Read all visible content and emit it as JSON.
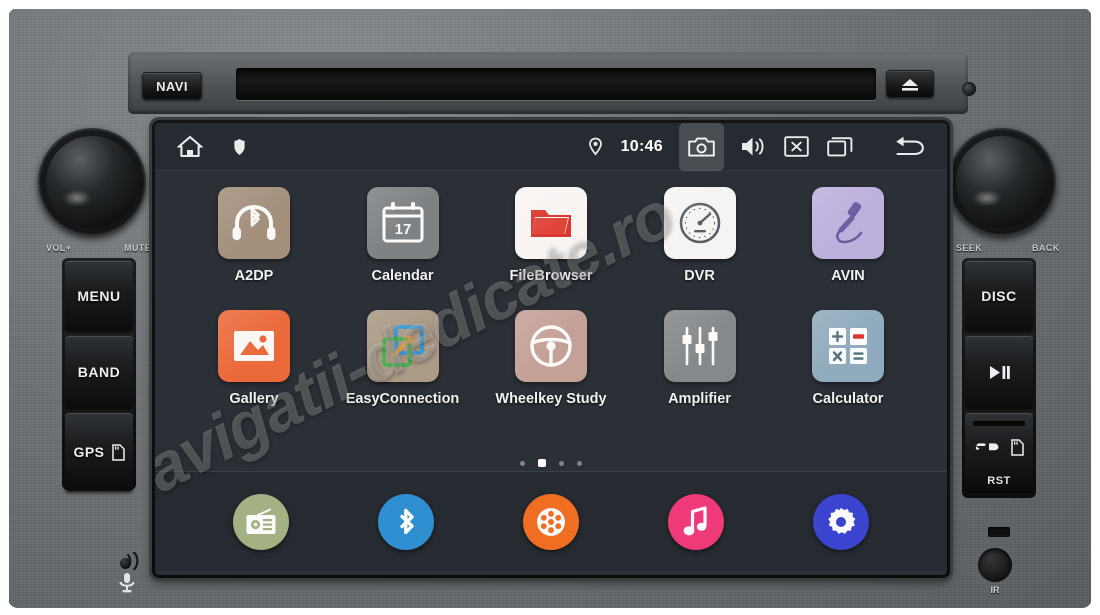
{
  "device": {
    "name": "car-head-unit",
    "top_panel": {
      "navi_button": "NAVI",
      "eject_icon": "eject-icon",
      "disc_slot": "disc-slot"
    },
    "knobs": {
      "left_label_a": "VOL+",
      "left_label_b": "MUTE",
      "right_label_a": "SEEK",
      "right_label_b": "BACK"
    },
    "left_buttons": [
      {
        "label": "MENU",
        "icon": null
      },
      {
        "label": "BAND",
        "icon": null
      },
      {
        "label": "GPS",
        "icon": "sd-card-icon"
      }
    ],
    "right_buttons": [
      {
        "label": "DISC",
        "icon": null
      },
      {
        "label": "",
        "icon": "play-pause-icon"
      },
      {
        "label": "",
        "icon": "sd-card-slot-icon",
        "sublabel": "RST"
      }
    ],
    "bottom": {
      "mic_icon": "microphone-icon",
      "ir_label": "IR"
    }
  },
  "screen": {
    "statusbar": {
      "home_icon": "home-icon",
      "shield_icon": "shield-icon",
      "location_icon": "location-pin-icon",
      "time": "10:46",
      "camera_icon": "camera-icon",
      "volume_icon": "speaker-icon",
      "close_icon": "close-box-icon",
      "recents_icon": "recents-icon",
      "back_icon": "back-arrow-icon"
    },
    "apps": [
      [
        {
          "label": "A2DP",
          "icon": "bluetooth-headphones-icon",
          "tile_color": "#a4907d",
          "glyph_color": "#ffffff"
        },
        {
          "label": "Calendar",
          "icon": "calendar-icon",
          "tile_color": "#7f8285",
          "glyph_color": "#ffffff",
          "day": "17"
        },
        {
          "label": "FileBrowser",
          "icon": "folder-icon",
          "tile_color": "#f7f4f2",
          "glyph_color": "#d32b2b"
        },
        {
          "label": "DVR",
          "icon": "speedometer-icon",
          "tile_color": "#f4f4f3",
          "glyph_color": "#5a5f64"
        },
        {
          "label": "AVIN",
          "icon": "audio-jack-icon",
          "tile_color": "#bdb0dd",
          "glyph_color": "#6b5ca0"
        }
      ],
      [
        {
          "label": "Gallery",
          "icon": "photo-icon",
          "tile_color": "#ea6a3c",
          "glyph_color": "#ffffff"
        },
        {
          "label": "EasyConnection",
          "icon": "screen-mirror-icon",
          "tile_color": "#ab9a86",
          "glyph_color": "#3c9ad6"
        },
        {
          "label": "Wheelkey Study",
          "icon": "steering-wheel-icon",
          "tile_color": "#c4a197",
          "glyph_color": "#ffffff"
        },
        {
          "label": "Amplifier",
          "icon": "equalizer-icon",
          "tile_color": "#86898c",
          "glyph_color": "#ffffff"
        },
        {
          "label": "Calculator",
          "icon": "calculator-icon",
          "tile_color": "#8fabbd",
          "glyph_color": "#ffffff"
        }
      ]
    ],
    "page_dots": {
      "count": 4,
      "active_index": 1
    },
    "dock": [
      {
        "name": "radio",
        "icon": "radio-icon",
        "color": "#a3b183"
      },
      {
        "name": "bluetooth",
        "icon": "bluetooth-icon",
        "color": "#2f8fd0"
      },
      {
        "name": "video",
        "icon": "film-reel-icon",
        "color": "#ef6e22"
      },
      {
        "name": "music",
        "icon": "music-note-icon",
        "color": "#ef3a7a"
      },
      {
        "name": "settings",
        "icon": "gear-icon",
        "color": "#3b44cf"
      }
    ],
    "watermark": "navigatii-dedicate.ro"
  }
}
